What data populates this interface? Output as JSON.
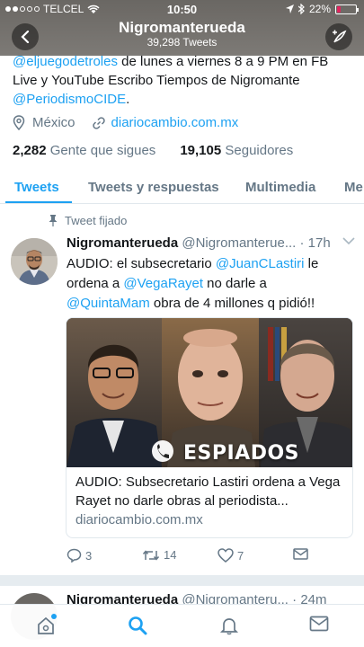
{
  "status_bar": {
    "carrier": "TELCEL",
    "time": "10:50",
    "battery": "22%",
    "battery_level": 0.22
  },
  "header": {
    "title": "Nigromanterueda",
    "subtitle": "39,298 Tweets"
  },
  "bio": {
    "line1_link": "@eljuegodetroles",
    "line1_text": " de lunes a viernes 8 a 9 PM en FB Live y YouTube Escribo Tiempos de Nigromante ",
    "line2_link": "@PeriodismoCIDE",
    "line2_end": "."
  },
  "location": "México",
  "website": "diariocambio.com.mx",
  "following": {
    "count": "2,282",
    "label": "Gente que sigues"
  },
  "followers": {
    "count": "19,105",
    "label": "Seguidores"
  },
  "tabs": [
    {
      "label": "Tweets"
    },
    {
      "label": "Tweets y respuestas"
    },
    {
      "label": "Multimedia"
    },
    {
      "label": "Me"
    }
  ],
  "pinned_label": "Tweet fijado",
  "tweet": {
    "name": "Nigromanterueda",
    "handle": "@Nigromanterue...",
    "dot": " · ",
    "time": "17h",
    "text_a": "AUDIO: el subsecretario ",
    "mention1": "@JuanCLastiri",
    "text_b": " le ordena a ",
    "mention2": "@VegaRayet",
    "text_c": " no darle a ",
    "mention3": "@QuintaMam",
    "text_d": " obra de 4 millones q pidió!!",
    "card": {
      "image_caption": "ESPIADOS",
      "title": "AUDIO: Subsecretario Lastiri ordena a Vega Rayet no darle obras al periodista...",
      "domain": "diariocambio.com.mx"
    },
    "replies": "3",
    "retweets": "14",
    "likes": "7"
  },
  "tweet2": {
    "name": "Nigromanterueda",
    "handle": "@Nigromanteru...",
    "dot": " · ",
    "time": "24m"
  },
  "colors": {
    "accent": "#1da1f2",
    "header_bg": "#6a6763",
    "text_secondary": "#657786",
    "battery": "#e0245e"
  }
}
